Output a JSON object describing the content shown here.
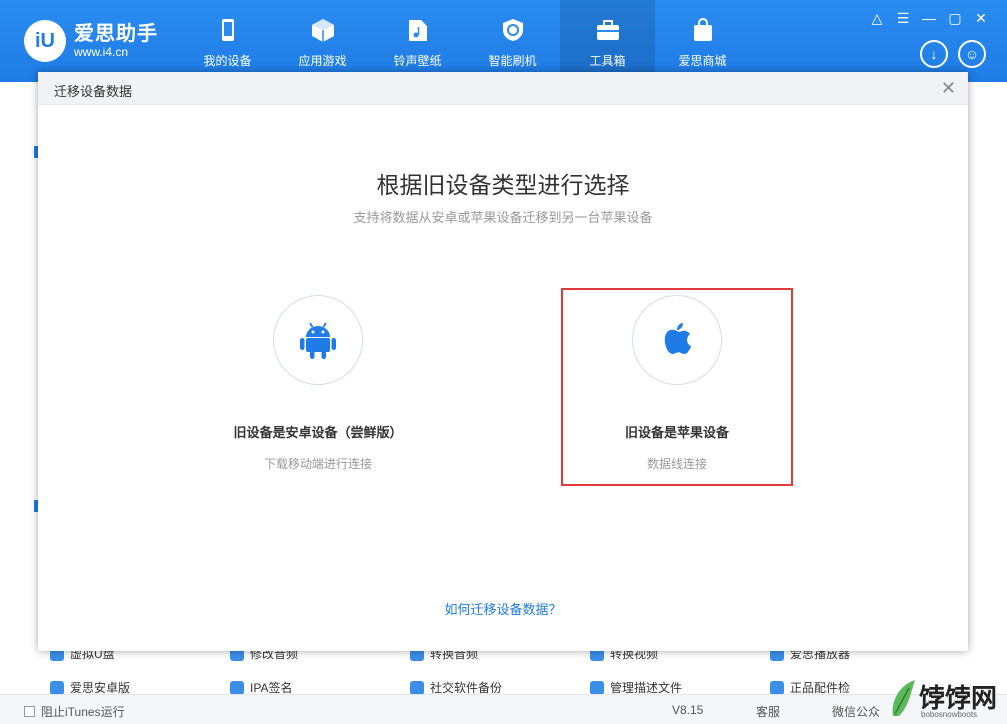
{
  "app": {
    "logo_mark": "iU",
    "name": "爱思助手",
    "url": "www.i4.cn"
  },
  "nav": [
    {
      "label": "我的设备",
      "icon": "phone-icon"
    },
    {
      "label": "应用游戏",
      "icon": "cube-icon"
    },
    {
      "label": "铃声壁纸",
      "icon": "music-file-icon"
    },
    {
      "label": "智能刷机",
      "icon": "refresh-shield-icon"
    },
    {
      "label": "工具箱",
      "icon": "toolbox-icon"
    },
    {
      "label": "爱思商城",
      "icon": "shopping-bag-icon"
    }
  ],
  "window_controls": [
    "shirt-icon",
    "menu-icon",
    "minimize-icon",
    "maximize-icon",
    "close-icon"
  ],
  "background_rows": [
    [
      "虚拟U盘",
      "修改音频",
      "转换音频",
      "转换视频",
      "爱思播放器"
    ],
    [
      "爱思安卓版",
      "IPA签名",
      "社交软件备份",
      "管理描述文件",
      "正品配件检"
    ]
  ],
  "modal": {
    "title": "迁移设备数据",
    "heading": "根据旧设备类型进行选择",
    "subheading": "支持将数据从安卓或苹果设备迁移到另一台苹果设备",
    "options": [
      {
        "title": "旧设备是安卓设备（尝鲜版）",
        "sub": "下载移动端进行连接",
        "icon": "android-icon"
      },
      {
        "title": "旧设备是苹果设备",
        "sub": "数据线连接",
        "icon": "apple-icon"
      }
    ],
    "help_link": "如何迁移设备数据？"
  },
  "statusbar": {
    "itunes_label": "阻止iTunes运行",
    "version": "V8.15",
    "service": "客服",
    "wechat": "微信公众"
  },
  "watermark": {
    "text": "饽饽网",
    "sub": "bobosnowboots"
  },
  "colors": {
    "brand_blue": "#1f7ce6",
    "highlight_red": "#e03a3a"
  }
}
